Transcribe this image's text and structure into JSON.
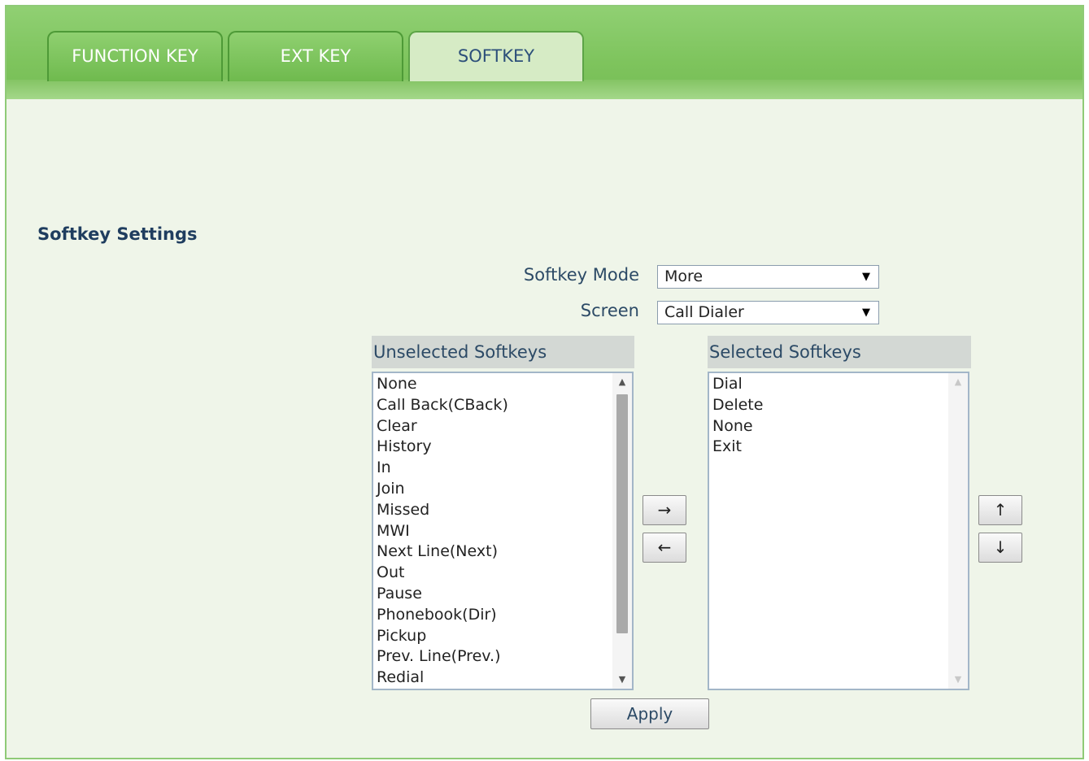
{
  "tabs": [
    {
      "label": "FUNCTION KEY"
    },
    {
      "label": "EXT KEY"
    },
    {
      "label": "SOFTKEY"
    }
  ],
  "section_title": "Softkey Settings",
  "softkey_mode": {
    "label": "Softkey Mode",
    "value": "More"
  },
  "screen": {
    "label": "Screen",
    "value": "Call Dialer"
  },
  "unselected": {
    "header": "Unselected Softkeys",
    "items": [
      "None",
      "Call Back(CBack)",
      "Clear",
      "History",
      "In",
      "Join",
      "Missed",
      "MWI",
      "Next Line(Next)",
      "Out",
      "Pause",
      "Phonebook(Dir)",
      "Pickup",
      "Prev. Line(Prev.)",
      "Redial"
    ]
  },
  "selected": {
    "header": "Selected Softkeys",
    "items": [
      "Dial",
      "Delete",
      "None",
      "Exit"
    ]
  },
  "buttons": {
    "move_right": "→",
    "move_left": "←",
    "move_up": "↑",
    "move_down": "↓",
    "apply": "Apply"
  },
  "icons": {
    "dropdown": "▼",
    "scroll_up": "▲",
    "scroll_down": "▼"
  },
  "colors": {
    "tab_green": "#7ec45d",
    "panel_bg": "#eff5e9",
    "label_text": "#2c4a66"
  }
}
